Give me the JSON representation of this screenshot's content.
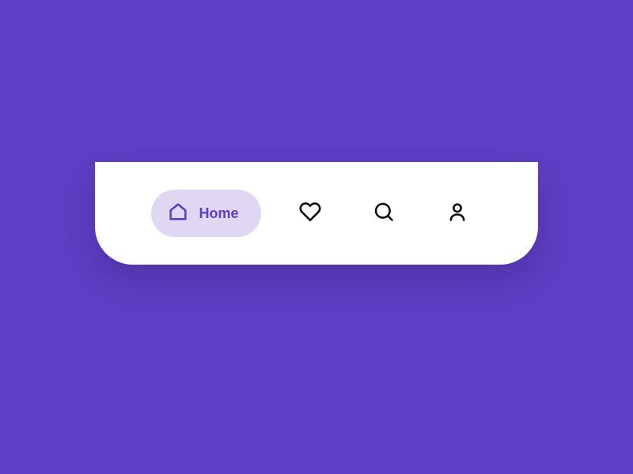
{
  "nav": {
    "items": [
      {
        "label": "Home",
        "active": true
      },
      {
        "label": "Favorites",
        "active": false
      },
      {
        "label": "Search",
        "active": false
      },
      {
        "label": "Profile",
        "active": false
      }
    ]
  },
  "colors": {
    "background": "#5f3dc4",
    "navBackground": "#ffffff",
    "activeBackground": "#e0d7f3",
    "activeIcon": "#5f3dc4",
    "inactiveIcon": "#0b0d0e"
  }
}
